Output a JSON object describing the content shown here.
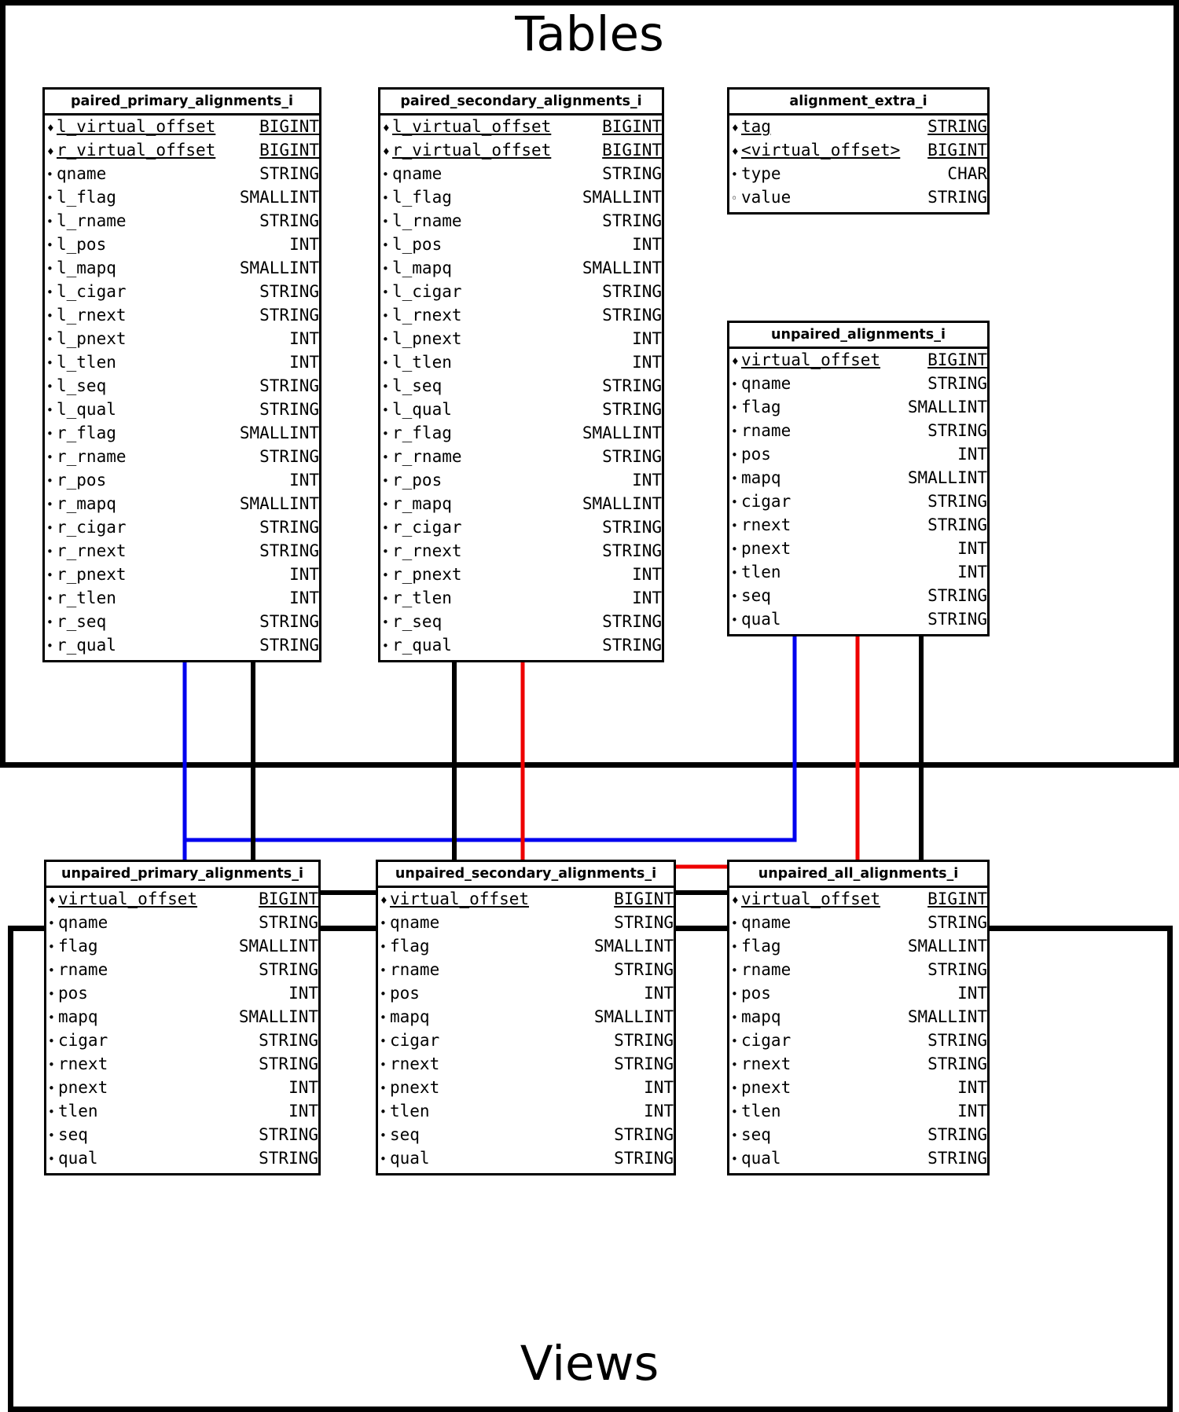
{
  "sections": {
    "tables": {
      "title": "Tables"
    },
    "views": {
      "title": "Views"
    }
  },
  "field_markers": {
    "key": "diamond-filled",
    "required": "dot-filled",
    "nullable": "circle-hollow"
  },
  "connector_colors": {
    "blue": "#0000ee",
    "red": "#ee0000",
    "black": "#000000"
  },
  "entities": {
    "paired_primary_alignments_i": {
      "name": "paired_primary_alignments_i",
      "section": "tables",
      "fields": [
        {
          "marker": "key",
          "name": "l_virtual_offset",
          "type": "BIGINT"
        },
        {
          "marker": "key",
          "name": "r_virtual_offset",
          "type": "BIGINT"
        },
        {
          "marker": "required",
          "name": "qname",
          "type": "STRING"
        },
        {
          "marker": "required",
          "name": "l_flag",
          "type": "SMALLINT"
        },
        {
          "marker": "required",
          "name": "l_rname",
          "type": "STRING"
        },
        {
          "marker": "required",
          "name": "l_pos",
          "type": "INT"
        },
        {
          "marker": "required",
          "name": "l_mapq",
          "type": "SMALLINT"
        },
        {
          "marker": "required",
          "name": "l_cigar",
          "type": "STRING"
        },
        {
          "marker": "required",
          "name": "l_rnext",
          "type": "STRING"
        },
        {
          "marker": "required",
          "name": "l_pnext",
          "type": "INT"
        },
        {
          "marker": "required",
          "name": "l_tlen",
          "type": "INT"
        },
        {
          "marker": "required",
          "name": "l_seq",
          "type": "STRING"
        },
        {
          "marker": "required",
          "name": "l_qual",
          "type": "STRING"
        },
        {
          "marker": "required",
          "name": "r_flag",
          "type": "SMALLINT"
        },
        {
          "marker": "required",
          "name": "r_rname",
          "type": "STRING"
        },
        {
          "marker": "required",
          "name": "r_pos",
          "type": "INT"
        },
        {
          "marker": "required",
          "name": "r_mapq",
          "type": "SMALLINT"
        },
        {
          "marker": "required",
          "name": "r_cigar",
          "type": "STRING"
        },
        {
          "marker": "required",
          "name": "r_rnext",
          "type": "STRING"
        },
        {
          "marker": "required",
          "name": "r_pnext",
          "type": "INT"
        },
        {
          "marker": "required",
          "name": "r_tlen",
          "type": "INT"
        },
        {
          "marker": "required",
          "name": "r_seq",
          "type": "STRING"
        },
        {
          "marker": "required",
          "name": "r_qual",
          "type": "STRING"
        }
      ]
    },
    "paired_secondary_alignments_i": {
      "name": "paired_secondary_alignments_i",
      "section": "tables",
      "fields": [
        {
          "marker": "key",
          "name": "l_virtual_offset",
          "type": "BIGINT"
        },
        {
          "marker": "key",
          "name": "r_virtual_offset",
          "type": "BIGINT"
        },
        {
          "marker": "required",
          "name": "qname",
          "type": "STRING"
        },
        {
          "marker": "required",
          "name": "l_flag",
          "type": "SMALLINT"
        },
        {
          "marker": "required",
          "name": "l_rname",
          "type": "STRING"
        },
        {
          "marker": "required",
          "name": "l_pos",
          "type": "INT"
        },
        {
          "marker": "required",
          "name": "l_mapq",
          "type": "SMALLINT"
        },
        {
          "marker": "required",
          "name": "l_cigar",
          "type": "STRING"
        },
        {
          "marker": "required",
          "name": "l_rnext",
          "type": "STRING"
        },
        {
          "marker": "required",
          "name": "l_pnext",
          "type": "INT"
        },
        {
          "marker": "required",
          "name": "l_tlen",
          "type": "INT"
        },
        {
          "marker": "required",
          "name": "l_seq",
          "type": "STRING"
        },
        {
          "marker": "required",
          "name": "l_qual",
          "type": "STRING"
        },
        {
          "marker": "required",
          "name": "r_flag",
          "type": "SMALLINT"
        },
        {
          "marker": "required",
          "name": "r_rname",
          "type": "STRING"
        },
        {
          "marker": "required",
          "name": "r_pos",
          "type": "INT"
        },
        {
          "marker": "required",
          "name": "r_mapq",
          "type": "SMALLINT"
        },
        {
          "marker": "required",
          "name": "r_cigar",
          "type": "STRING"
        },
        {
          "marker": "required",
          "name": "r_rnext",
          "type": "STRING"
        },
        {
          "marker": "required",
          "name": "r_pnext",
          "type": "INT"
        },
        {
          "marker": "required",
          "name": "r_tlen",
          "type": "INT"
        },
        {
          "marker": "required",
          "name": "r_seq",
          "type": "STRING"
        },
        {
          "marker": "required",
          "name": "r_qual",
          "type": "STRING"
        }
      ]
    },
    "alignment_extra_i": {
      "name": "alignment_extra_i",
      "section": "tables",
      "fields": [
        {
          "marker": "key",
          "name": "tag",
          "type": "STRING"
        },
        {
          "marker": "key",
          "name": "<virtual_offset>",
          "type": "BIGINT"
        },
        {
          "marker": "required",
          "name": "type",
          "type": "CHAR"
        },
        {
          "marker": "nullable",
          "name": "value",
          "type": "STRING"
        }
      ]
    },
    "unpaired_alignments_i": {
      "name": "unpaired_alignments_i",
      "section": "tables",
      "fields": [
        {
          "marker": "key",
          "name": "virtual_offset",
          "type": "BIGINT"
        },
        {
          "marker": "required",
          "name": "qname",
          "type": "STRING"
        },
        {
          "marker": "required",
          "name": "flag",
          "type": "SMALLINT"
        },
        {
          "marker": "required",
          "name": "rname",
          "type": "STRING"
        },
        {
          "marker": "required",
          "name": "pos",
          "type": "INT"
        },
        {
          "marker": "required",
          "name": "mapq",
          "type": "SMALLINT"
        },
        {
          "marker": "required",
          "name": "cigar",
          "type": "STRING"
        },
        {
          "marker": "required",
          "name": "rnext",
          "type": "STRING"
        },
        {
          "marker": "required",
          "name": "pnext",
          "type": "INT"
        },
        {
          "marker": "required",
          "name": "tlen",
          "type": "INT"
        },
        {
          "marker": "required",
          "name": "seq",
          "type": "STRING"
        },
        {
          "marker": "required",
          "name": "qual",
          "type": "STRING"
        }
      ]
    },
    "unpaired_primary_alignments_i": {
      "name": "unpaired_primary_alignments_i",
      "section": "views",
      "fields": [
        {
          "marker": "key",
          "name": "virtual_offset",
          "type": "BIGINT"
        },
        {
          "marker": "required",
          "name": "qname",
          "type": "STRING"
        },
        {
          "marker": "required",
          "name": "flag",
          "type": "SMALLINT"
        },
        {
          "marker": "required",
          "name": "rname",
          "type": "STRING"
        },
        {
          "marker": "required",
          "name": "pos",
          "type": "INT"
        },
        {
          "marker": "required",
          "name": "mapq",
          "type": "SMALLINT"
        },
        {
          "marker": "required",
          "name": "cigar",
          "type": "STRING"
        },
        {
          "marker": "required",
          "name": "rnext",
          "type": "STRING"
        },
        {
          "marker": "required",
          "name": "pnext",
          "type": "INT"
        },
        {
          "marker": "required",
          "name": "tlen",
          "type": "INT"
        },
        {
          "marker": "required",
          "name": "seq",
          "type": "STRING"
        },
        {
          "marker": "required",
          "name": "qual",
          "type": "STRING"
        }
      ]
    },
    "unpaired_secondary_alignments_i": {
      "name": "unpaired_secondary_alignments_i",
      "section": "views",
      "fields": [
        {
          "marker": "key",
          "name": "virtual_offset",
          "type": "BIGINT"
        },
        {
          "marker": "required",
          "name": "qname",
          "type": "STRING"
        },
        {
          "marker": "required",
          "name": "flag",
          "type": "SMALLINT"
        },
        {
          "marker": "required",
          "name": "rname",
          "type": "STRING"
        },
        {
          "marker": "required",
          "name": "pos",
          "type": "INT"
        },
        {
          "marker": "required",
          "name": "mapq",
          "type": "SMALLINT"
        },
        {
          "marker": "required",
          "name": "cigar",
          "type": "STRING"
        },
        {
          "marker": "required",
          "name": "rnext",
          "type": "STRING"
        },
        {
          "marker": "required",
          "name": "pnext",
          "type": "INT"
        },
        {
          "marker": "required",
          "name": "tlen",
          "type": "INT"
        },
        {
          "marker": "required",
          "name": "seq",
          "type": "STRING"
        },
        {
          "marker": "required",
          "name": "qual",
          "type": "STRING"
        }
      ]
    },
    "unpaired_all_alignments_i": {
      "name": "unpaired_all_alignments_i",
      "section": "views",
      "fields": [
        {
          "marker": "key",
          "name": "virtual_offset",
          "type": "BIGINT"
        },
        {
          "marker": "required",
          "name": "qname",
          "type": "STRING"
        },
        {
          "marker": "required",
          "name": "flag",
          "type": "SMALLINT"
        },
        {
          "marker": "required",
          "name": "rname",
          "type": "STRING"
        },
        {
          "marker": "required",
          "name": "pos",
          "type": "INT"
        },
        {
          "marker": "required",
          "name": "mapq",
          "type": "SMALLINT"
        },
        {
          "marker": "required",
          "name": "cigar",
          "type": "STRING"
        },
        {
          "marker": "required",
          "name": "rnext",
          "type": "STRING"
        },
        {
          "marker": "required",
          "name": "pnext",
          "type": "INT"
        },
        {
          "marker": "required",
          "name": "tlen",
          "type": "INT"
        },
        {
          "marker": "required",
          "name": "seq",
          "type": "STRING"
        },
        {
          "marker": "required",
          "name": "qual",
          "type": "STRING"
        }
      ]
    }
  },
  "relationships": [
    {
      "from": "unpaired_primary_alignments_i",
      "to": "paired_primary_alignments_i",
      "color": "blue"
    },
    {
      "from": "unpaired_primary_alignments_i",
      "to": "unpaired_alignments_i",
      "color": "blue"
    },
    {
      "from": "unpaired_secondary_alignments_i",
      "to": "paired_secondary_alignments_i",
      "color": "red"
    },
    {
      "from": "unpaired_secondary_alignments_i",
      "to": "unpaired_alignments_i",
      "color": "red"
    },
    {
      "from": "unpaired_all_alignments_i",
      "to": "paired_primary_alignments_i",
      "color": "black"
    },
    {
      "from": "unpaired_all_alignments_i",
      "to": "paired_secondary_alignments_i",
      "color": "black"
    },
    {
      "from": "unpaired_all_alignments_i",
      "to": "unpaired_alignments_i",
      "color": "black"
    }
  ]
}
